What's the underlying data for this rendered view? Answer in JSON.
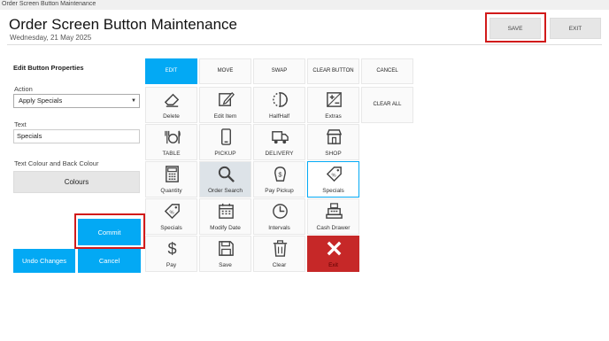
{
  "window": {
    "title": "Order Screen Button Maintenance"
  },
  "header": {
    "title": "Order Screen Button Maintenance",
    "date": "Wednesday, 21 May 2025",
    "save_label": "SAVE",
    "exit_label": "EXIT"
  },
  "panel": {
    "title": "Edit Button Properties",
    "action_label": "Action",
    "action_value": "Apply Specials",
    "text_label": "Text",
    "text_value": "Specials",
    "colour_label": "Text Colour and Back Colour",
    "colours_button": "Colours",
    "commit": "Commit",
    "undo": "Undo Changes",
    "cancel": "Cancel"
  },
  "modes": [
    "EDIT",
    "MOVE",
    "SWAP",
    "CLEAR BUTTON",
    "CANCEL"
  ],
  "active_mode": "EDIT",
  "clear_all": "CLEAR ALL",
  "grid": [
    {
      "label": "Delete",
      "icon": "eraser-icon"
    },
    {
      "label": "Edit Item",
      "icon": "edit-icon"
    },
    {
      "label": "HalfHalf",
      "icon": "half-circle-icon"
    },
    {
      "label": "Extras",
      "icon": "plus-minus-icon"
    },
    {
      "label": "TABLE",
      "icon": "table-dining-icon"
    },
    {
      "label": "PICKUP",
      "icon": "phone-icon"
    },
    {
      "label": "DELIVERY",
      "icon": "truck-icon"
    },
    {
      "label": "SHOP",
      "icon": "shop-icon"
    },
    {
      "label": "Quantity",
      "icon": "calculator-icon"
    },
    {
      "label": "Order Search",
      "icon": "magnifier-icon"
    },
    {
      "label": "Pay Pickup",
      "icon": "pay-pickup-icon"
    },
    {
      "label": "Specials",
      "icon": "tag-icon"
    },
    {
      "label": "Specials",
      "icon": "tag-icon"
    },
    {
      "label": "Modify Date",
      "icon": "calendar-icon"
    },
    {
      "label": "Intervals",
      "icon": "clock-icon"
    },
    {
      "label": "Cash Drawer",
      "icon": "cash-register-icon"
    },
    {
      "label": "Pay",
      "icon": "dollar-icon"
    },
    {
      "label": "Save",
      "icon": "floppy-icon"
    },
    {
      "label": "Clear",
      "icon": "trash-icon"
    },
    {
      "label": "Exit",
      "icon": "x-icon"
    }
  ],
  "colors": {
    "accent": "#03a9f4",
    "exit": "#c62828",
    "highlight": "#d11a1a"
  }
}
